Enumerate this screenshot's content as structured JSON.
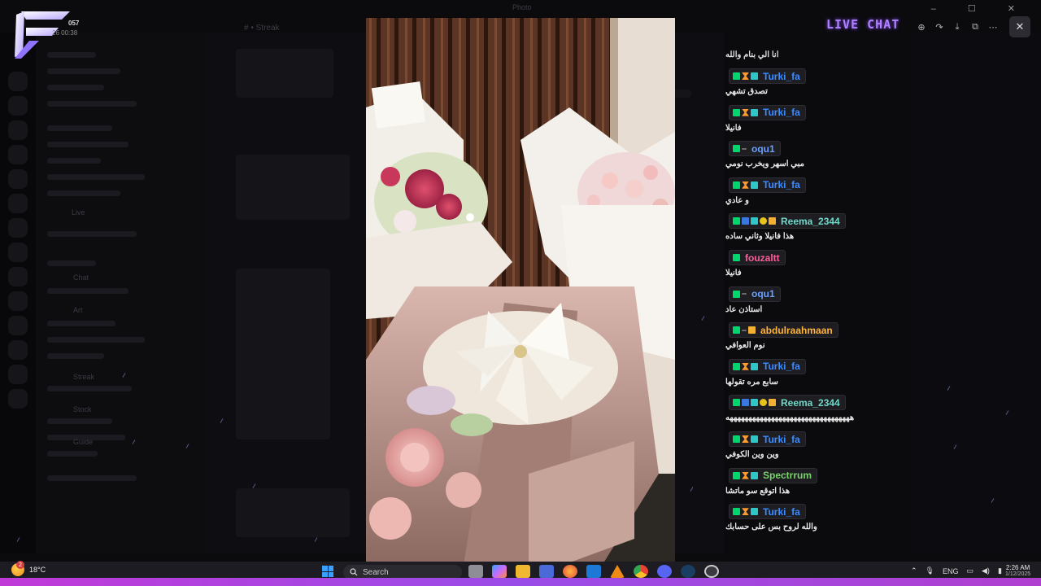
{
  "window": {
    "title": "Photo"
  },
  "background": {
    "channel_title": "# • Streak",
    "channel_labels": [
      "Live",
      "Chat",
      "Art",
      "Streak",
      "Stock",
      "Guide"
    ]
  },
  "logo": {
    "badge": "057",
    "date": "26 00:38"
  },
  "overlay": {
    "title": "LIVE CHAT"
  },
  "viewer_toolbar": {
    "icons": [
      "zoom-in-icon",
      "share-icon",
      "download-icon",
      "open-external-icon",
      "more-icon"
    ],
    "close_icon": "close-icon"
  },
  "chat": {
    "first_message": "انا الي بنام والله",
    "messages": [
      {
        "user": "Turki_fa",
        "color": "#3b8cff",
        "badges": [
          "k",
          "f",
          "t"
        ],
        "text": "تصدق تشهي"
      },
      {
        "user": "Turki_fa",
        "color": "#3b8cff",
        "badges": [
          "k",
          "f",
          "t"
        ],
        "text": "فانيلا"
      },
      {
        "user": "oqu1",
        "color": "#6aa0ff",
        "badges": [
          "k",
          "g"
        ],
        "text": "مبي اسهر ويخرب نومي"
      },
      {
        "user": "Turki_fa",
        "color": "#3b8cff",
        "badges": [
          "k",
          "f",
          "t"
        ],
        "text": "و عادي"
      },
      {
        "user": "Reema_2344",
        "color": "#6fd8c8",
        "badges": [
          "k",
          "d",
          "t",
          "y",
          "c"
        ],
        "text": "هذا فانيلا وثاني ساده"
      },
      {
        "user": "fouzaltt",
        "color": "#ff5c9a",
        "badges": [
          "k"
        ],
        "text": "فانيلا"
      },
      {
        "user": "oqu1",
        "color": "#6aa0ff",
        "badges": [
          "k",
          "g"
        ],
        "text": "استاذن عاد"
      },
      {
        "user": "abdulraahmaan",
        "color": "#ffb43c",
        "badges": [
          "k",
          "g",
          "c"
        ],
        "text": "نوم العوافي"
      },
      {
        "user": "Turki_fa",
        "color": "#3b8cff",
        "badges": [
          "k",
          "f",
          "t"
        ],
        "text": "سابع مره تقولها"
      },
      {
        "user": "Reema_2344",
        "color": "#6fd8c8",
        "badges": [
          "k",
          "d",
          "t",
          "y",
          "c"
        ],
        "text": "هههههههههههههههههههههههههههههههههه"
      },
      {
        "user": "Turki_fa",
        "color": "#3b8cff",
        "badges": [
          "k",
          "f",
          "t"
        ],
        "text": "وين وين الكوفي"
      },
      {
        "user": "Spectrrum",
        "color": "#7ad36a",
        "badges": [
          "k",
          "f",
          "t"
        ],
        "text": "هذا اتوقع سو ماتشا"
      },
      {
        "user": "Turki_fa",
        "color": "#3b8cff",
        "badges": [
          "k",
          "f",
          "t"
        ],
        "text": "والله لروح بس على حسابك"
      }
    ]
  },
  "taskbar": {
    "weather_temp": "18°C",
    "weather_badge": "2",
    "search_label": "Search",
    "language": "ENG",
    "time": "2:26 AM",
    "date": "1/12/2025",
    "apps": [
      "file-explorer-icon",
      "copilot-icon",
      "folder-icon",
      "store-icon",
      "firefox-icon",
      "outlook-icon",
      "vlc-icon",
      "chrome-icon",
      "discord-icon",
      "steam-icon",
      "obs-icon"
    ]
  }
}
